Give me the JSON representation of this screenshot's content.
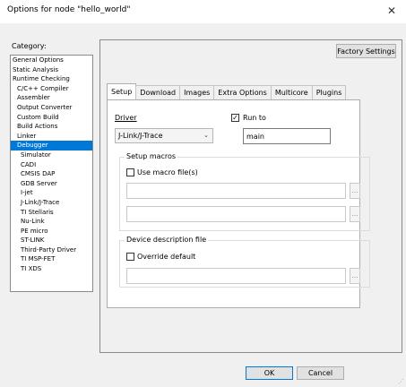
{
  "window": {
    "title": "Options for node \"hello_world\""
  },
  "category": {
    "label": "Category:",
    "items": [
      {
        "label": "General Options",
        "level": 0
      },
      {
        "label": "Static Analysis",
        "level": 0
      },
      {
        "label": "Runtime Checking",
        "level": 0
      },
      {
        "label": "C/C++ Compiler",
        "level": 1
      },
      {
        "label": "Assembler",
        "level": 1
      },
      {
        "label": "Output Converter",
        "level": 1
      },
      {
        "label": "Custom Build",
        "level": 1
      },
      {
        "label": "Build Actions",
        "level": 1
      },
      {
        "label": "Linker",
        "level": 1
      },
      {
        "label": "Debugger",
        "level": 1,
        "selected": true
      },
      {
        "label": "Simulator",
        "level": 2
      },
      {
        "label": "CADI",
        "level": 2
      },
      {
        "label": "CMSIS DAP",
        "level": 2
      },
      {
        "label": "GDB Server",
        "level": 2
      },
      {
        "label": "I-jet",
        "level": 2
      },
      {
        "label": "J-Link/J-Trace",
        "level": 2
      },
      {
        "label": "TI Stellaris",
        "level": 2
      },
      {
        "label": "Nu-Link",
        "level": 2
      },
      {
        "label": "PE micro",
        "level": 2
      },
      {
        "label": "ST-LINK",
        "level": 2
      },
      {
        "label": "Third-Party Driver",
        "level": 2
      },
      {
        "label": "TI MSP-FET",
        "level": 2
      },
      {
        "label": "TI XDS",
        "level": 2
      }
    ]
  },
  "factory_settings_label": "Factory Settings",
  "tabs": [
    {
      "label": "Setup",
      "active": true
    },
    {
      "label": "Download"
    },
    {
      "label": "Images"
    },
    {
      "label": "Extra Options"
    },
    {
      "label": "Multicore"
    },
    {
      "label": "Plugins"
    }
  ],
  "setup": {
    "driver_label": "Driver",
    "driver_value": "J-Link/J-Trace",
    "run_to_label": "Run to",
    "run_to_checked": true,
    "run_to_value": "main",
    "setup_macros_label": "Setup macros",
    "use_macro_label": "Use macro file(s)",
    "device_desc_label": "Device description file",
    "override_default_label": "Override default",
    "browse_label": "..."
  },
  "footer": {
    "ok_label": "OK",
    "cancel_label": "Cancel"
  },
  "icons": {
    "close": "close-icon",
    "dropdown": "chevron-down-icon",
    "check": "check-icon"
  }
}
